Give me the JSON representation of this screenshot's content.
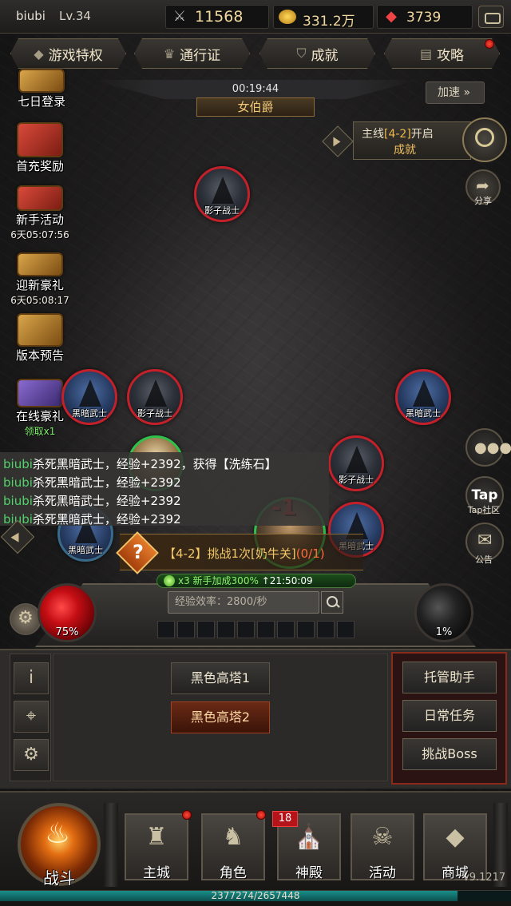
{
  "player": {
    "name": "biubi",
    "level": "Lv.34"
  },
  "resources": {
    "power": "11568",
    "gold": "331.2万",
    "gems": "3739"
  },
  "menu": {
    "privilege": "游戏特权",
    "pass": "通行证",
    "achievement": "成就",
    "guide": "攻略"
  },
  "boss": {
    "timer": "00:19:44",
    "title": "女伯爵"
  },
  "speed_label": "加速",
  "side_activities": [
    {
      "label": "七日登录"
    },
    {
      "label": "首充奖励"
    },
    {
      "label": "新手活动",
      "sub": "6天05:07:56"
    },
    {
      "label": "迎新豪礼",
      "sub": "6天05:08:17"
    },
    {
      "label": "版本预告"
    },
    {
      "label": "在线豪礼",
      "sub": "领取x1"
    }
  ],
  "quest": {
    "prefix": "主线",
    "stage": "[4-2]",
    "suffix": "开启",
    "reward": "成就"
  },
  "right_icons": {
    "share": "分享",
    "tap": "Tap",
    "tap_label": "Tap社区",
    "notice": "公告"
  },
  "units": {
    "shadow_warrior": "影子战士",
    "dark_warrior": "黑暗武士"
  },
  "damage": "-1",
  "combat_log": [
    {
      "name": "biubi",
      "text": "杀死黑暗武士，经验+2392，获得【洗练石】"
    },
    {
      "name": "biubi",
      "text": "杀死黑暗武士，经验+2392"
    },
    {
      "name": "biubi",
      "text": "杀死黑暗武士，经验+2392"
    },
    {
      "name": "biubi",
      "text": "杀死黑暗武士，经验+2392"
    }
  ],
  "challenge": {
    "text": "【4-2】挑战1次[奶牛关]",
    "progress": "(0/1)"
  },
  "buff": {
    "text": "x3 新手加成300%",
    "time": "↑21:50:09"
  },
  "exp_rate_placeholder": "经验效率：2800/秒",
  "hp_percent": "75%",
  "mp_percent": "1%",
  "towers": [
    "黑色高塔1",
    "黑色高塔2"
  ],
  "right_buttons": {
    "auto": "托管助手",
    "daily": "日常任务",
    "boss": "挑战Boss"
  },
  "bottom_nav": {
    "battle": "战斗",
    "city": "主城",
    "role": "角色",
    "temple": "神殿",
    "activity": "活动",
    "shop": "商城",
    "temple_badge": "18"
  },
  "version": "v9.1217",
  "exp": {
    "text": "2377274/2657448",
    "fraction": 0.8946
  },
  "colors": {
    "accent_gold": "#f0c060",
    "player_green": "#4fd36a",
    "alert_red": "#c4202a"
  }
}
